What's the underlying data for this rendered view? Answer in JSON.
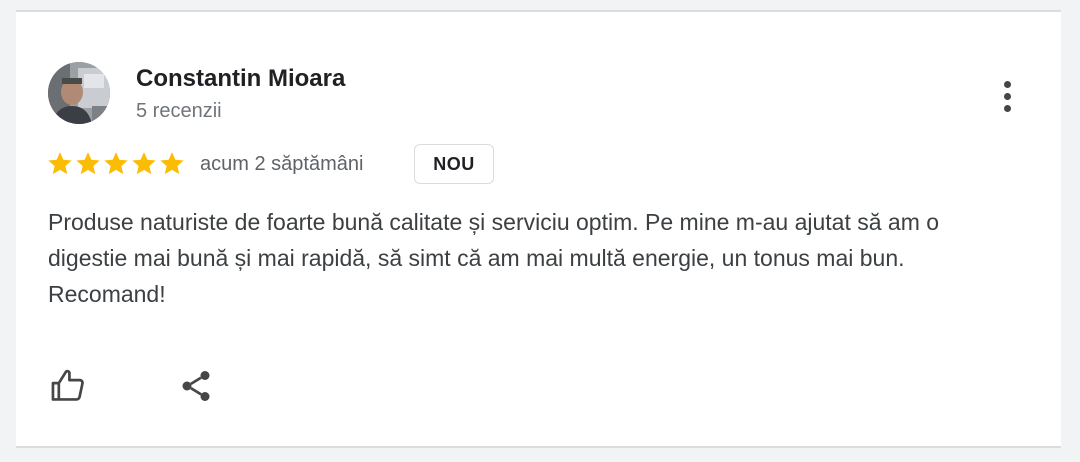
{
  "review": {
    "author": {
      "name": "Constantin Mioara",
      "reviews_count": "5 recenzii",
      "avatar": "user-photo"
    },
    "rating": {
      "stars": 5,
      "max": 5,
      "color": "#fbbc04"
    },
    "time": "acum 2 săptămâni",
    "badge": "NOU",
    "text": "Produse naturiste de foarte bună calitate și serviciu optim. Pe mine m-au ajutat să am o digestie mai bună și mai rapidă, să simt că am mai multă energie, un tonus mai bun. Recomand!",
    "actions": {
      "like_icon": "thumb-up-icon",
      "share_icon": "share-icon",
      "more_icon": "more-vert-icon"
    }
  }
}
